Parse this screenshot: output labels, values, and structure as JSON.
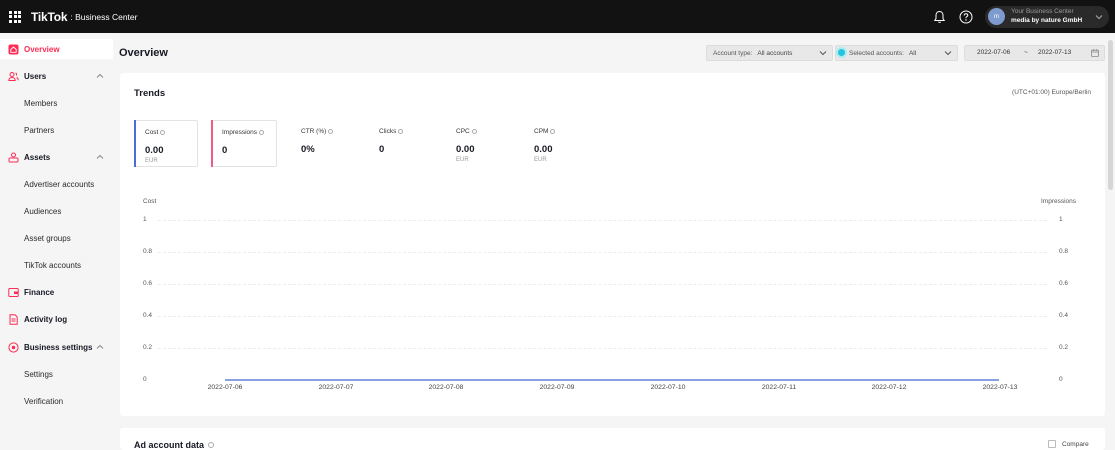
{
  "header": {
    "logo": "TikTok",
    "product": ": Business Center",
    "account_line1": "Your Business Center",
    "account_line2": "media by nature GmbH",
    "avatar_initial": "m",
    "icons": [
      "apps-grid-icon",
      "bell-icon",
      "help-icon",
      "chevron-down-icon"
    ]
  },
  "sidebar": {
    "items": [
      {
        "label": "Overview",
        "icon": "home-icon"
      },
      {
        "label": "Users",
        "icon": "users-icon"
      },
      {
        "label": "Members"
      },
      {
        "label": "Partners"
      },
      {
        "label": "Assets",
        "icon": "assets-icon"
      },
      {
        "label": "Advertiser accounts"
      },
      {
        "label": "Audiences"
      },
      {
        "label": "Asset groups"
      },
      {
        "label": "TikTok accounts"
      },
      {
        "label": "Finance",
        "icon": "finance-icon"
      },
      {
        "label": "Activity log",
        "icon": "activity-log-icon"
      },
      {
        "label": "Business settings",
        "icon": "settings-icon"
      },
      {
        "label": "Settings"
      },
      {
        "label": "Verification"
      }
    ]
  },
  "page": {
    "title": "Overview",
    "filters": {
      "account_type_label": "Account type:",
      "account_type_value": "All accounts",
      "selected_accounts_label": "Selected accounts:",
      "selected_accounts_value": "All"
    },
    "date_range": {
      "start": "2022-07-06",
      "separator": "~",
      "end": "2022-07-13"
    }
  },
  "trends": {
    "title": "Trends",
    "timezone": "(UTC+01:00) Europe/Berlin",
    "metrics": [
      {
        "label": "Cost",
        "value": "0.00",
        "unit": "EUR"
      },
      {
        "label": "Impressions",
        "value": "0",
        "unit": ""
      },
      {
        "label": "CTR (%)",
        "value": "0%",
        "unit": ""
      },
      {
        "label": "Clicks",
        "value": "0",
        "unit": ""
      },
      {
        "label": "CPC",
        "value": "0.00",
        "unit": "EUR"
      },
      {
        "label": "CPM",
        "value": "0.00",
        "unit": "EUR"
      }
    ],
    "chart": {
      "left_axis_label": "Cost",
      "right_axis_label": "Impressions",
      "y_ticks": [
        "1",
        "0.8",
        "0.6",
        "0.4",
        "0.2",
        "0"
      ],
      "x_ticks": [
        "2022-07-06",
        "2022-07-07",
        "2022-07-08",
        "2022-07-09",
        "2022-07-10",
        "2022-07-11",
        "2022-07-12",
        "2022-07-13"
      ],
      "series_values": [
        0,
        0,
        0,
        0,
        0,
        0,
        0,
        0
      ]
    }
  },
  "ad_account": {
    "title": "Ad account data",
    "compare_label": "Compare"
  },
  "colors": {
    "accent": "#fe2c55",
    "cost_series": "#4f6bd6",
    "impressions_series": "#ef5c86",
    "topbar": "#121212"
  }
}
